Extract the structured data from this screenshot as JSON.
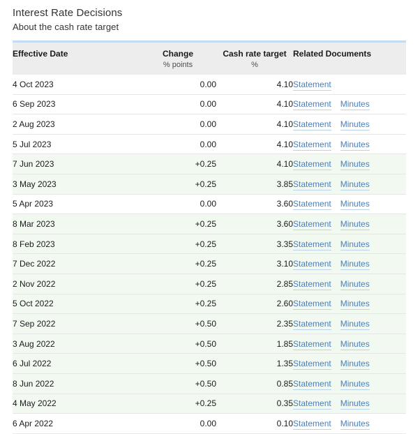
{
  "page": {
    "title": "Interest Rate Decisions",
    "subtitle": "About the cash rate target"
  },
  "colors": {
    "header_bg": "#ededed",
    "header_top_border": "#c3dcf2",
    "row_change_bg": "#f1f9f1",
    "row_flat_bg": "#ffffff",
    "link": "#4a7ebb",
    "text": "#1a1a1a"
  },
  "table": {
    "columns": [
      {
        "label": "Effective Date",
        "sub": "",
        "align": "left"
      },
      {
        "label": "Change",
        "sub": "% points",
        "align": "right"
      },
      {
        "label": "Cash rate target",
        "sub": "%",
        "align": "right"
      },
      {
        "label": "Related Documents",
        "sub": "",
        "align": "left"
      }
    ],
    "link_labels": {
      "statement": "Statement",
      "minutes": "Minutes"
    },
    "rows": [
      {
        "date": "4 Oct 2023",
        "change": "0.00",
        "target": "4.10",
        "docs": [
          "Statement"
        ],
        "highlight": false
      },
      {
        "date": "6 Sep 2023",
        "change": "0.00",
        "target": "4.10",
        "docs": [
          "Statement",
          "Minutes"
        ],
        "highlight": false
      },
      {
        "date": "2 Aug 2023",
        "change": "0.00",
        "target": "4.10",
        "docs": [
          "Statement",
          "Minutes"
        ],
        "highlight": false
      },
      {
        "date": "5 Jul 2023",
        "change": "0.00",
        "target": "4.10",
        "docs": [
          "Statement",
          "Minutes"
        ],
        "highlight": false
      },
      {
        "date": "7 Jun 2023",
        "change": "+0.25",
        "target": "4.10",
        "docs": [
          "Statement",
          "Minutes"
        ],
        "highlight": true
      },
      {
        "date": "3 May 2023",
        "change": "+0.25",
        "target": "3.85",
        "docs": [
          "Statement",
          "Minutes"
        ],
        "highlight": true
      },
      {
        "date": "5 Apr 2023",
        "change": "0.00",
        "target": "3.60",
        "docs": [
          "Statement",
          "Minutes"
        ],
        "highlight": false
      },
      {
        "date": "8 Mar 2023",
        "change": "+0.25",
        "target": "3.60",
        "docs": [
          "Statement",
          "Minutes"
        ],
        "highlight": true
      },
      {
        "date": "8 Feb 2023",
        "change": "+0.25",
        "target": "3.35",
        "docs": [
          "Statement",
          "Minutes"
        ],
        "highlight": true
      },
      {
        "date": "7 Dec 2022",
        "change": "+0.25",
        "target": "3.10",
        "docs": [
          "Statement",
          "Minutes"
        ],
        "highlight": true
      },
      {
        "date": "2 Nov 2022",
        "change": "+0.25",
        "target": "2.85",
        "docs": [
          "Statement",
          "Minutes"
        ],
        "highlight": true
      },
      {
        "date": "5 Oct 2022",
        "change": "+0.25",
        "target": "2.60",
        "docs": [
          "Statement",
          "Minutes"
        ],
        "highlight": true
      },
      {
        "date": "7 Sep 2022",
        "change": "+0.50",
        "target": "2.35",
        "docs": [
          "Statement",
          "Minutes"
        ],
        "highlight": true
      },
      {
        "date": "3 Aug 2022",
        "change": "+0.50",
        "target": "1.85",
        "docs": [
          "Statement",
          "Minutes"
        ],
        "highlight": true
      },
      {
        "date": "6 Jul 2022",
        "change": "+0.50",
        "target": "1.35",
        "docs": [
          "Statement",
          "Minutes"
        ],
        "highlight": true
      },
      {
        "date": "8 Jun 2022",
        "change": "+0.50",
        "target": "0.85",
        "docs": [
          "Statement",
          "Minutes"
        ],
        "highlight": true
      },
      {
        "date": "4 May 2022",
        "change": "+0.25",
        "target": "0.35",
        "docs": [
          "Statement",
          "Minutes"
        ],
        "highlight": true
      },
      {
        "date": "6 Apr 2022",
        "change": "0.00",
        "target": "0.10",
        "docs": [
          "Statement",
          "Minutes"
        ],
        "highlight": false
      }
    ]
  }
}
